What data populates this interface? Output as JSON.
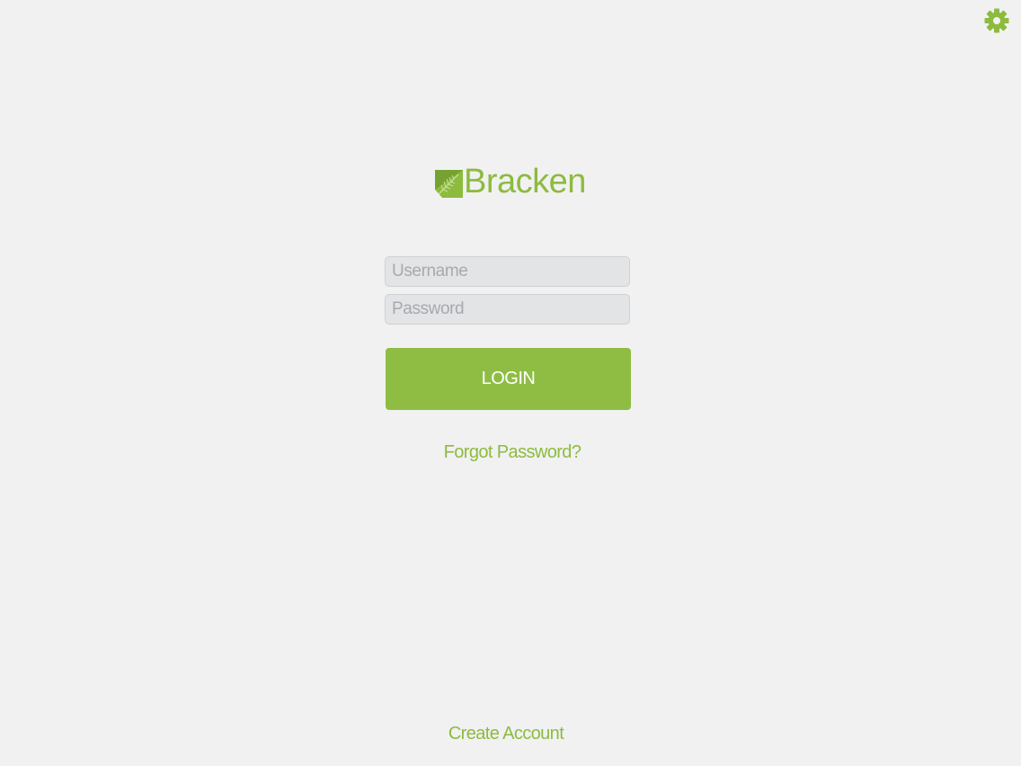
{
  "app": {
    "name": "Bracken",
    "accent_color": "#8fbd43",
    "background_color": "#f1f1f2"
  },
  "header": {
    "settings_icon": "gear-icon"
  },
  "logo": {
    "text": "Bracken",
    "mark_icon": "fern-leaf-icon"
  },
  "login_form": {
    "username": {
      "placeholder": "Username",
      "value": ""
    },
    "password": {
      "placeholder": "Password",
      "value": ""
    },
    "login_label": "LOGIN",
    "forgot_password_label": "Forgot Password?"
  },
  "footer": {
    "create_account_label": "Create Account"
  }
}
